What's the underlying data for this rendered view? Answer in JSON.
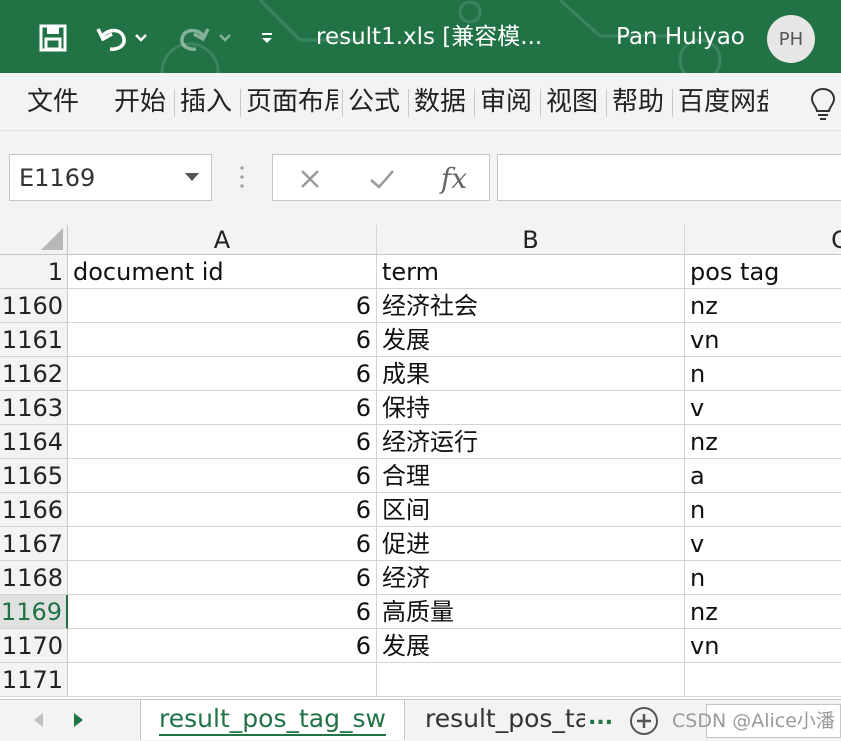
{
  "window": {
    "doc_title": "result1.xls  [兼容模...",
    "user_name": "Pan Huiyao",
    "user_initials": "PH",
    "accent_color": "#217346"
  },
  "quick_access": {
    "save_icon": "save-icon",
    "undo_icon": "undo-icon",
    "redo_icon": "redo-icon",
    "customize_icon": "customize-qat-icon"
  },
  "ribbon": {
    "tabs": [
      "文件",
      "开始",
      "插入",
      "页面布局",
      "公式",
      "数据",
      "审阅",
      "视图",
      "帮助",
      "百度网盘"
    ],
    "tell_me_icon": "lightbulb-icon"
  },
  "formula_bar": {
    "name_box": "E1169",
    "formula": "",
    "fx_label": "fx"
  },
  "grid": {
    "columns": [
      "A",
      "B",
      "C"
    ],
    "header_row": {
      "row": "1",
      "cells": [
        "document id",
        "term",
        "pos tag"
      ]
    },
    "rows": [
      {
        "row": "1160",
        "doc": "6",
        "term": "经济社会",
        "pos": "nz"
      },
      {
        "row": "1161",
        "doc": "6",
        "term": "发展",
        "pos": "vn"
      },
      {
        "row": "1162",
        "doc": "6",
        "term": "成果",
        "pos": "n"
      },
      {
        "row": "1163",
        "doc": "6",
        "term": "保持",
        "pos": "v"
      },
      {
        "row": "1164",
        "doc": "6",
        "term": "经济运行",
        "pos": "nz"
      },
      {
        "row": "1165",
        "doc": "6",
        "term": "合理",
        "pos": "a"
      },
      {
        "row": "1166",
        "doc": "6",
        "term": "区间",
        "pos": "n"
      },
      {
        "row": "1167",
        "doc": "6",
        "term": "促进",
        "pos": "v"
      },
      {
        "row": "1168",
        "doc": "6",
        "term": "经济",
        "pos": "n"
      },
      {
        "row": "1169",
        "doc": "6",
        "term": "高质量",
        "pos": "nz"
      },
      {
        "row": "1170",
        "doc": "6",
        "term": "发展",
        "pos": "vn"
      },
      {
        "row": "1171",
        "doc": "",
        "term": "",
        "pos": ""
      }
    ],
    "active_row": "1169"
  },
  "sheets": {
    "active": "result_pos_tag_sw",
    "other": "result_pos_tag",
    "more": "...",
    "add_icon": "add-sheet-icon"
  },
  "watermark": "CSDN @Alice小潘"
}
